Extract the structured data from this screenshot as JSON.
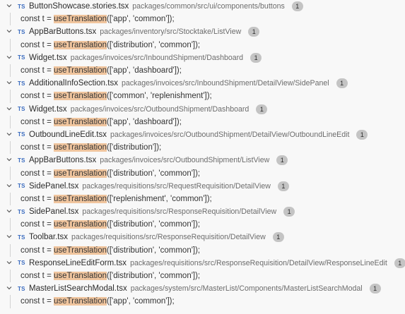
{
  "results": [
    {
      "lang": "TS",
      "file": "ButtonShowcase.stories.tsx",
      "path": "packages/common/src/ui/components/buttons",
      "count": "1",
      "line": {
        "pre": "const t = ",
        "match": "useTranslation",
        "post": "(['app', 'common']);"
      }
    },
    {
      "lang": "TS",
      "file": "AppBarButtons.tsx",
      "path": "packages/inventory/src/Stocktake/ListView",
      "count": "1",
      "line": {
        "pre": "const t = ",
        "match": "useTranslation",
        "post": "(['distribution', 'common']);"
      }
    },
    {
      "lang": "TS",
      "file": "Widget.tsx",
      "path": "packages/invoices/src/InboundShipment/Dashboard",
      "count": "1",
      "line": {
        "pre": "const t = ",
        "match": "useTranslation",
        "post": "(['app', 'dashboard']);"
      }
    },
    {
      "lang": "TS",
      "file": "AdditionalInfoSection.tsx",
      "path": "packages/invoices/src/InboundShipment/DetailView/SidePanel",
      "count": "1",
      "line": {
        "pre": "const t = ",
        "match": "useTranslation",
        "post": "(['common', 'replenishment']);"
      }
    },
    {
      "lang": "TS",
      "file": "Widget.tsx",
      "path": "packages/invoices/src/OutboundShipment/Dashboard",
      "count": "1",
      "line": {
        "pre": "const t = ",
        "match": "useTranslation",
        "post": "(['app', 'dashboard']);"
      }
    },
    {
      "lang": "TS",
      "file": "OutboundLineEdit.tsx",
      "path": "packages/invoices/src/OutboundShipment/DetailView/OutboundLineEdit",
      "count": "1",
      "line": {
        "pre": "const t = ",
        "match": "useTranslation",
        "post": "(['distribution']);"
      }
    },
    {
      "lang": "TS",
      "file": "AppBarButtons.tsx",
      "path": "packages/invoices/src/OutboundShipment/ListView",
      "count": "1",
      "line": {
        "pre": "const t = ",
        "match": "useTranslation",
        "post": "(['distribution', 'common']);"
      }
    },
    {
      "lang": "TS",
      "file": "SidePanel.tsx",
      "path": "packages/requisitions/src/RequestRequisition/DetailView",
      "count": "1",
      "line": {
        "pre": "const t = ",
        "match": "useTranslation",
        "post": "(['replenishment', 'common']);"
      }
    },
    {
      "lang": "TS",
      "file": "SidePanel.tsx",
      "path": "packages/requisitions/src/ResponseRequisition/DetailView",
      "count": "1",
      "line": {
        "pre": "const t = ",
        "match": "useTranslation",
        "post": "(['distribution', 'common']);"
      }
    },
    {
      "lang": "TS",
      "file": "Toolbar.tsx",
      "path": "packages/requisitions/src/ResponseRequisition/DetailView",
      "count": "1",
      "line": {
        "pre": "const t = ",
        "match": "useTranslation",
        "post": "(['distribution', 'common']);"
      }
    },
    {
      "lang": "TS",
      "file": "ResponseLineEditForm.tsx",
      "path": "packages/requisitions/src/ResponseRequisition/DetailView/ResponseLineEdit",
      "count": "1",
      "line": {
        "pre": "const t = ",
        "match": "useTranslation",
        "post": "(['distribution', 'common']);"
      }
    },
    {
      "lang": "TS",
      "file": "MasterListSearchModal.tsx",
      "path": "packages/system/src/MasterList/Components/MasterListSearchModal",
      "count": "1",
      "line": {
        "pre": "const t = ",
        "match": "useTranslation",
        "post": "(['app', 'common']);"
      }
    }
  ],
  "colors": {
    "match_highlight": "#f0c59e",
    "ts_icon": "#3a6bbf",
    "badge": "#c4c4c4"
  },
  "icons": {
    "expand": "chevron-down-icon",
    "file_type": "typescript-file-icon"
  }
}
